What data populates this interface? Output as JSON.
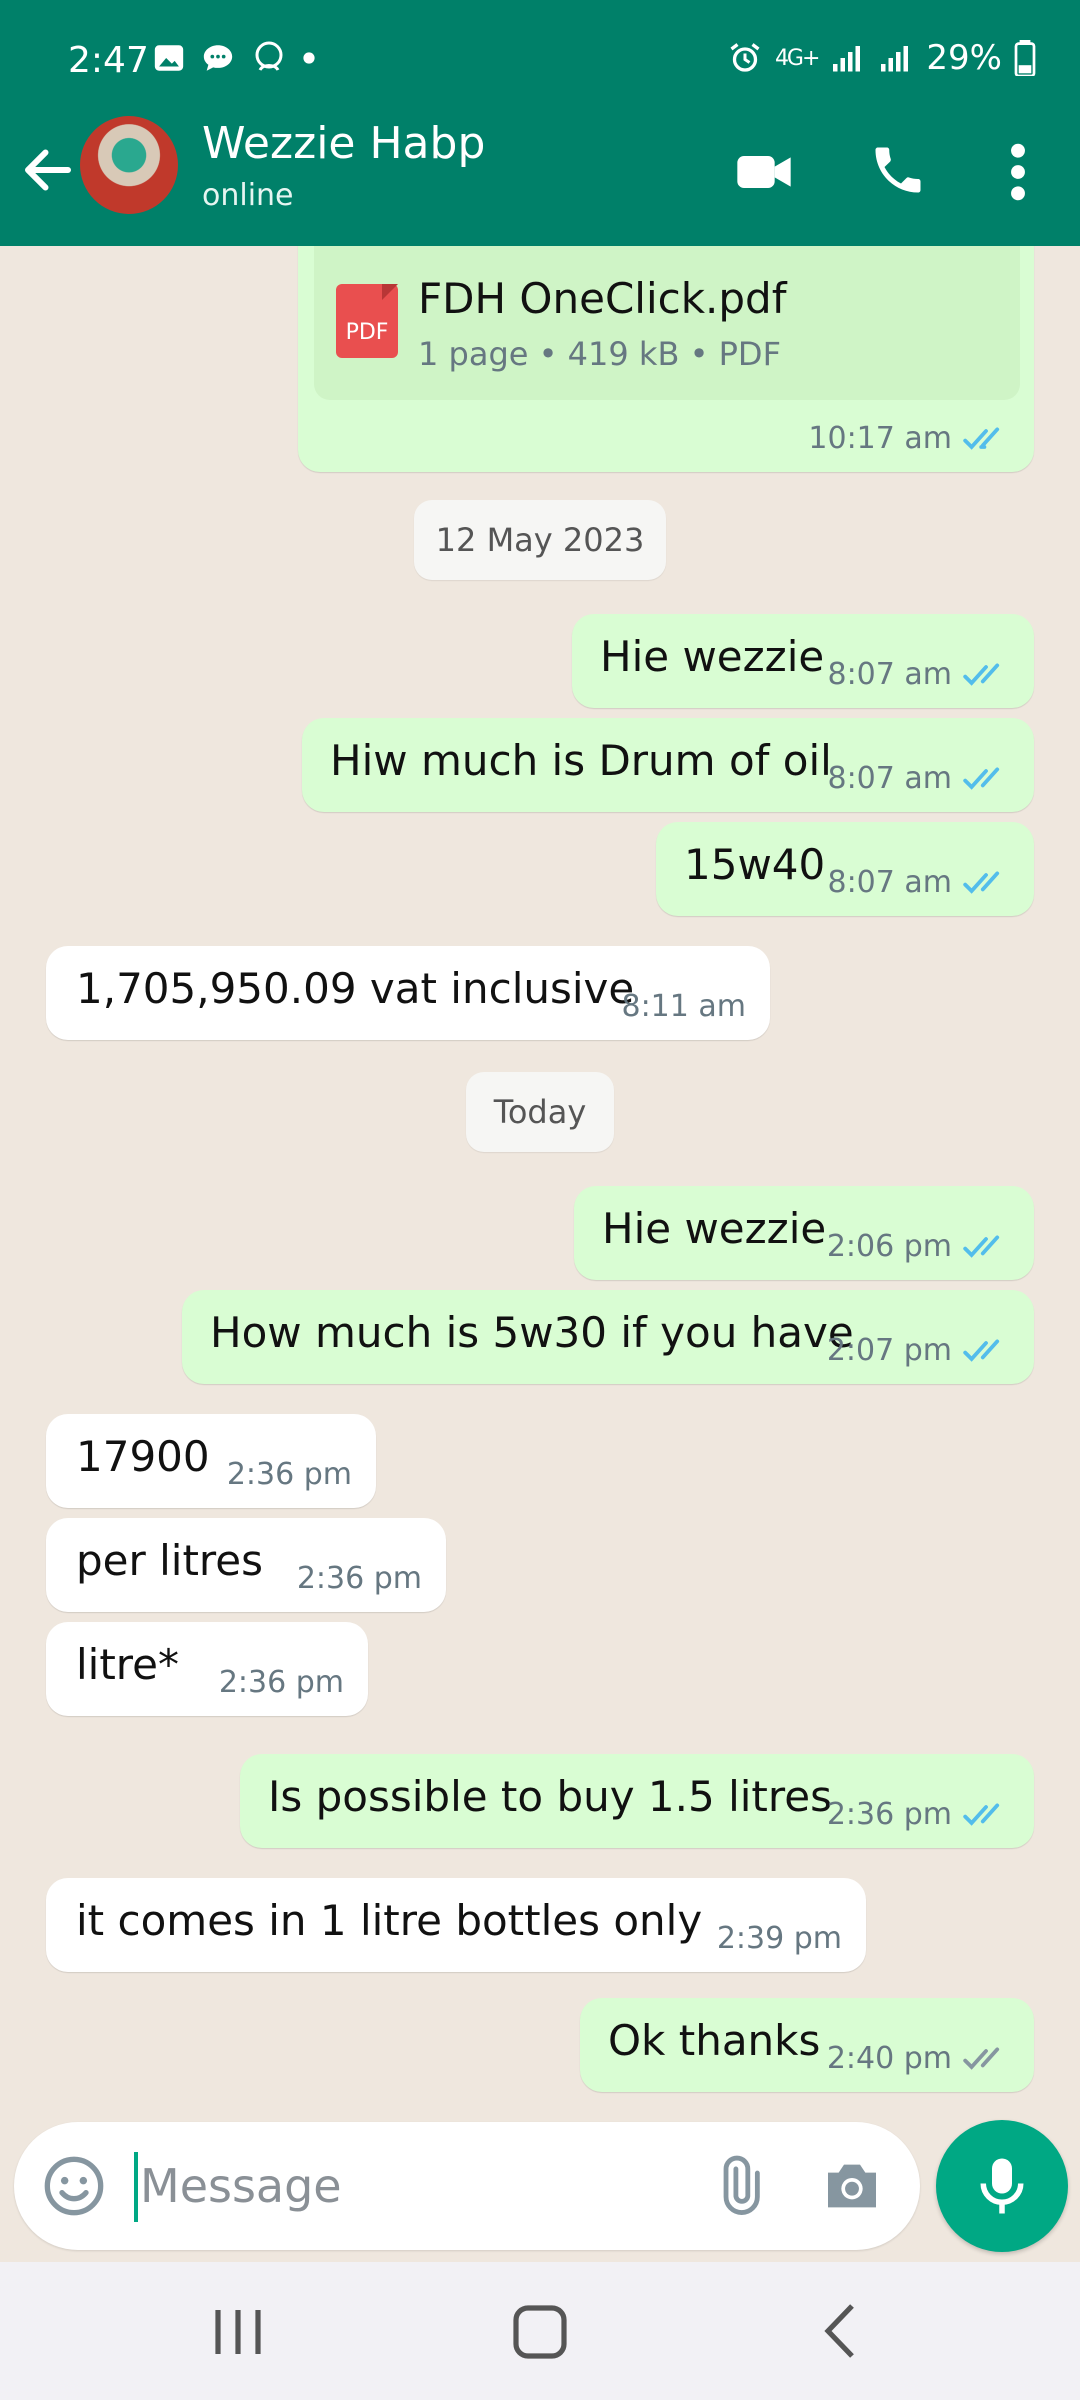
{
  "status_bar": {
    "time": "2:47",
    "network": "4G+",
    "battery": "29%"
  },
  "header": {
    "contact_name": "Wezzie Habp",
    "contact_status": "online"
  },
  "document": {
    "file_name": "FDH OneClick.pdf",
    "file_info": "1 page • 419 kB • PDF",
    "badge": "PDF",
    "time": "10:17 am"
  },
  "date_chips": [
    "12 May 2023",
    "Today"
  ],
  "messages": [
    {
      "text": "Hie wezzie",
      "time": "8:07 am",
      "direction": "outgoing",
      "status": "read"
    },
    {
      "text": "Hiw much is Drum of oil",
      "time": "8:07 am",
      "direction": "outgoing",
      "status": "read"
    },
    {
      "text": "15w40",
      "time": "8:07 am",
      "direction": "outgoing",
      "status": "read"
    },
    {
      "text": "1,705,950.09 vat inclusive",
      "time": "8:11 am",
      "direction": "incoming"
    },
    {
      "text": "Hie wezzie",
      "time": "2:06 pm",
      "direction": "outgoing",
      "status": "read"
    },
    {
      "text": "How much is 5w30 if you have",
      "time": "2:07 pm",
      "direction": "outgoing",
      "status": "read"
    },
    {
      "text": "17900",
      "time": "2:36 pm",
      "direction": "incoming"
    },
    {
      "text": "per litres",
      "time": "2:36 pm",
      "direction": "incoming"
    },
    {
      "text": "litre*",
      "time": "2:36 pm",
      "direction": "incoming"
    },
    {
      "text": "Is possible to buy 1.5 litres",
      "time": "2:36 pm",
      "direction": "outgoing",
      "status": "read"
    },
    {
      "text": "it comes in 1 litre bottles only",
      "time": "2:39 pm",
      "direction": "incoming"
    },
    {
      "text": "Ok thanks",
      "time": "2:40 pm",
      "direction": "outgoing",
      "status": "delivered"
    }
  ],
  "composer": {
    "placeholder": "Message"
  },
  "colors": {
    "header": "#008069",
    "outgoing_bubble": "#d9fdd3",
    "incoming_bubble": "#ffffff",
    "read_ticks": "#53bdeb",
    "unread_ticks": "#8696a0",
    "accent": "#00a884",
    "chat_background": "#efe7de"
  },
  "icons": [
    "back-arrow-icon",
    "video-call-icon",
    "phone-icon",
    "more-options-icon",
    "emoji-icon",
    "attach-icon",
    "camera-icon",
    "mic-icon"
  ]
}
